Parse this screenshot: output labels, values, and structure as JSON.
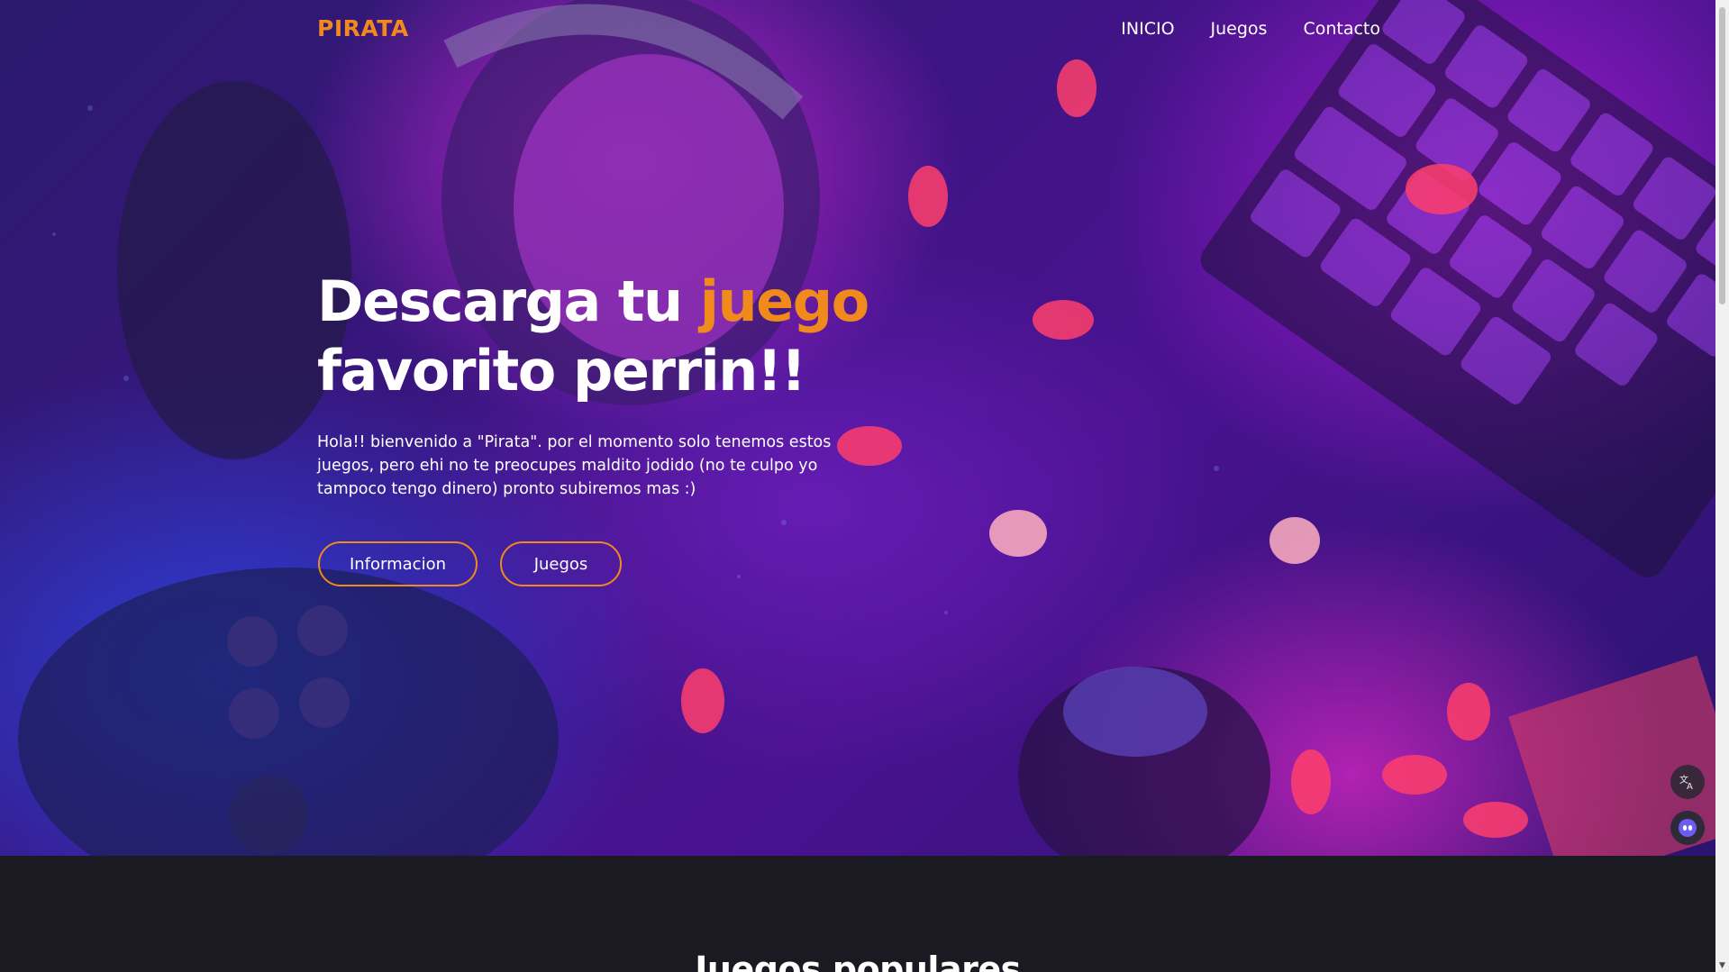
{
  "nav": {
    "logo": "PIRATA",
    "links": [
      {
        "label": "INICIO"
      },
      {
        "label": "Juegos"
      },
      {
        "label": "Contacto"
      }
    ]
  },
  "hero": {
    "headline_part1": "Descarga tu ",
    "headline_accent": "juego",
    "headline_part2": "favorito perrin!!",
    "intro": "Hola!! bienvenido a \"Pirata\". por el momento solo tenemos estos juegos, pero ehi no te preocupes maldito jodido (no te culpo yo tampoco tengo dinero) pronto subiremos mas :)",
    "buttons": {
      "info": "Informacion",
      "games": "Juegos"
    }
  },
  "popular": {
    "title": "Juegos populares"
  },
  "widgets": {
    "translate_icon": "translate-icon",
    "assistant_icon": "assistant-icon"
  },
  "colors": {
    "accent": "#f08a1c",
    "section_bg": "#1b1a22"
  }
}
